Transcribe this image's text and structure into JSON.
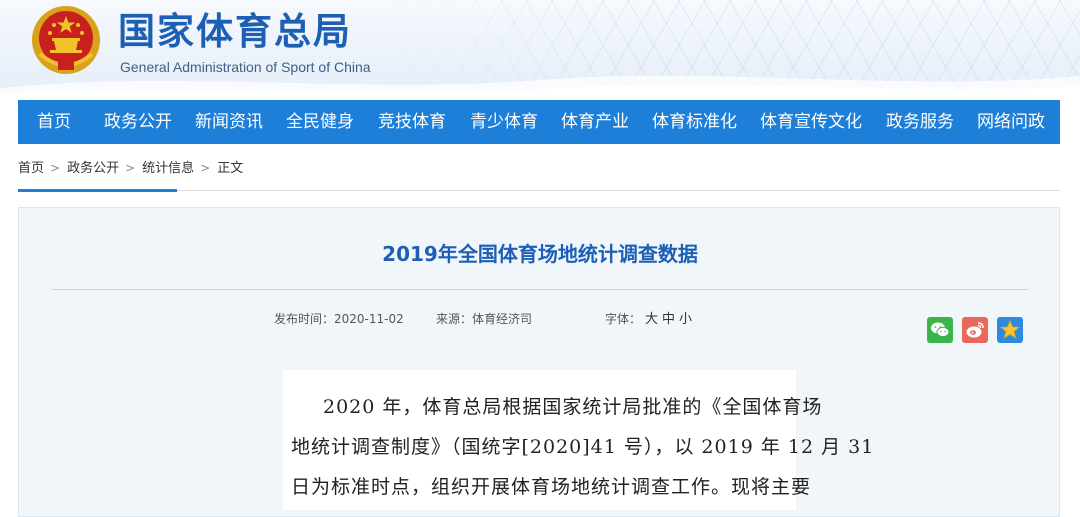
{
  "header": {
    "title": "国家体育总局",
    "subtitle": "General Administration of Sport of China",
    "emblem_icon": "national-emblem-icon"
  },
  "nav": {
    "items": [
      {
        "label": "首页"
      },
      {
        "label": "政务公开"
      },
      {
        "label": "新闻资讯"
      },
      {
        "label": "全民健身"
      },
      {
        "label": "竞技体育"
      },
      {
        "label": "青少体育"
      },
      {
        "label": "体育产业"
      },
      {
        "label": "体育标准化"
      },
      {
        "label": "体育宣传文化"
      },
      {
        "label": "政务服务"
      },
      {
        "label": "网络问政"
      }
    ]
  },
  "breadcrumb": {
    "items": [
      {
        "label": "首页"
      },
      {
        "label": "政务公开"
      },
      {
        "label": "统计信息"
      },
      {
        "label": "正文"
      }
    ],
    "separator": ">"
  },
  "article": {
    "title": "2019年全国体育场地统计调查数据",
    "publish_label": "发布时间：",
    "publish_date": "2020-11-02",
    "source_label": "来源：",
    "source": "体育经济司",
    "font_label": "字体：",
    "font_sizes": [
      "大",
      "中",
      "小"
    ],
    "share": [
      {
        "icon": "wechat-icon"
      },
      {
        "icon": "weibo-icon"
      },
      {
        "icon": "favorite-star-icon"
      }
    ],
    "body_lines": [
      "2020 年，体育总局根据国家统计局批准的《全国体育场",
      "地统计调查制度》（国统字[2020]41 号），以 2019 年 12 月 31",
      "日为标准时点，组织开展体育场地统计调查工作。现将主要"
    ]
  },
  "colors": {
    "brand_blue": "#1d5fb5",
    "nav_blue": "#1e7fd8",
    "article_bg": "#f1f6fb"
  }
}
